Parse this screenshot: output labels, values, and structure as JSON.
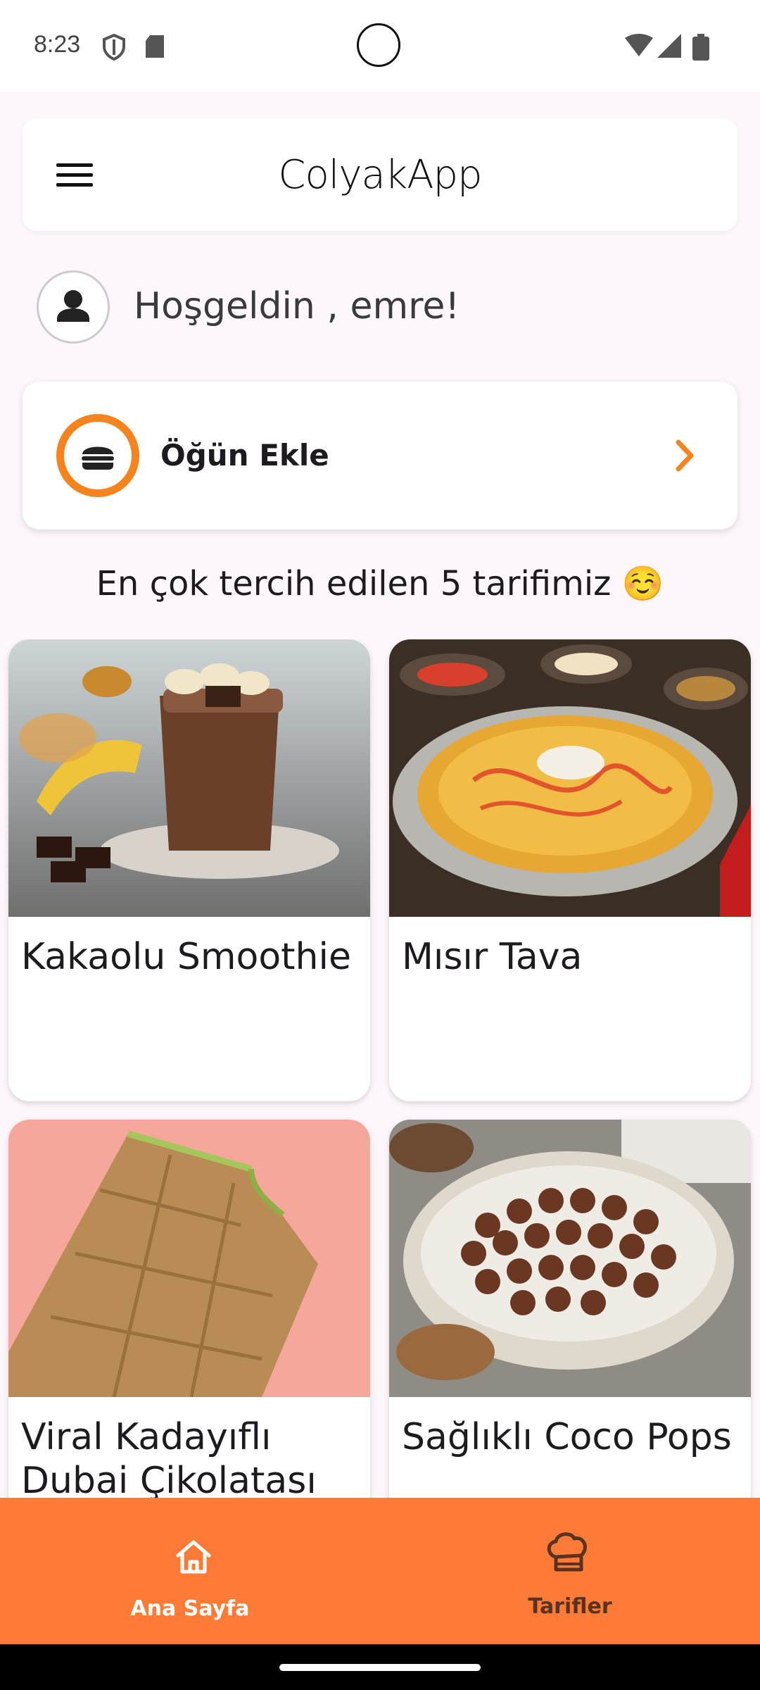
{
  "status_bar": {
    "time": "8:23"
  },
  "app_bar": {
    "title": "ColyakApp",
    "menu_icon": "menu-icon"
  },
  "greeting": {
    "text": "Hoşgeldin , emre!",
    "avatar_icon": "person-icon"
  },
  "meal_card": {
    "label": "Öğün Ekle",
    "icon": "burger-icon",
    "accent": "#f5841f"
  },
  "section": {
    "title": "En çok tercih edilen 5 tarifimiz ☺️"
  },
  "recipes": [
    {
      "name": "Kakaolu Smoothie"
    },
    {
      "name": "Mısır Tava"
    },
    {
      "name": "Viral Kadayıflı Dubai Çikolatası"
    },
    {
      "name": "Sağlıklı Coco Pops"
    }
  ],
  "bottom_nav": {
    "background": "#fd7b37",
    "items": [
      {
        "label": "Ana Sayfa",
        "icon": "home-icon",
        "active": true
      },
      {
        "label": "Tarifler",
        "icon": "chef-hat-icon",
        "active": false
      }
    ]
  }
}
